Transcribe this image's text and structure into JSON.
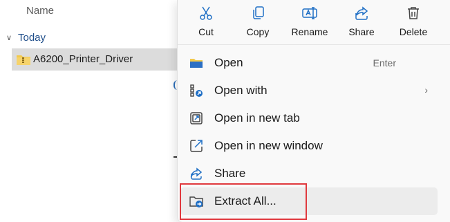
{
  "explorer": {
    "column_header": "Name",
    "group_label": "Today",
    "file_name": "A6200_Printer_Driver"
  },
  "context_menu": {
    "toolbar": [
      {
        "label": "Cut",
        "icon": "scissors-icon"
      },
      {
        "label": "Copy",
        "icon": "copy-icon"
      },
      {
        "label": "Rename",
        "icon": "rename-icon"
      },
      {
        "label": "Share",
        "icon": "share-icon"
      },
      {
        "label": "Delete",
        "icon": "trash-icon"
      }
    ],
    "items": [
      {
        "label": "Open",
        "accelerator": "Enter",
        "icon": "folder-open-icon"
      },
      {
        "label": "Open with",
        "submenu": "›",
        "icon": "open-with-icon"
      },
      {
        "label": "Open in new tab",
        "icon": "new-tab-icon"
      },
      {
        "label": "Open in new window",
        "icon": "new-window-icon"
      },
      {
        "label": "Share",
        "icon": "share-icon"
      },
      {
        "label": "Extract All...",
        "icon": "extract-icon"
      }
    ]
  },
  "colors": {
    "accent": "#1f6fc5",
    "highlight_border": "#e0393e",
    "selection": "#dcdcdc"
  }
}
